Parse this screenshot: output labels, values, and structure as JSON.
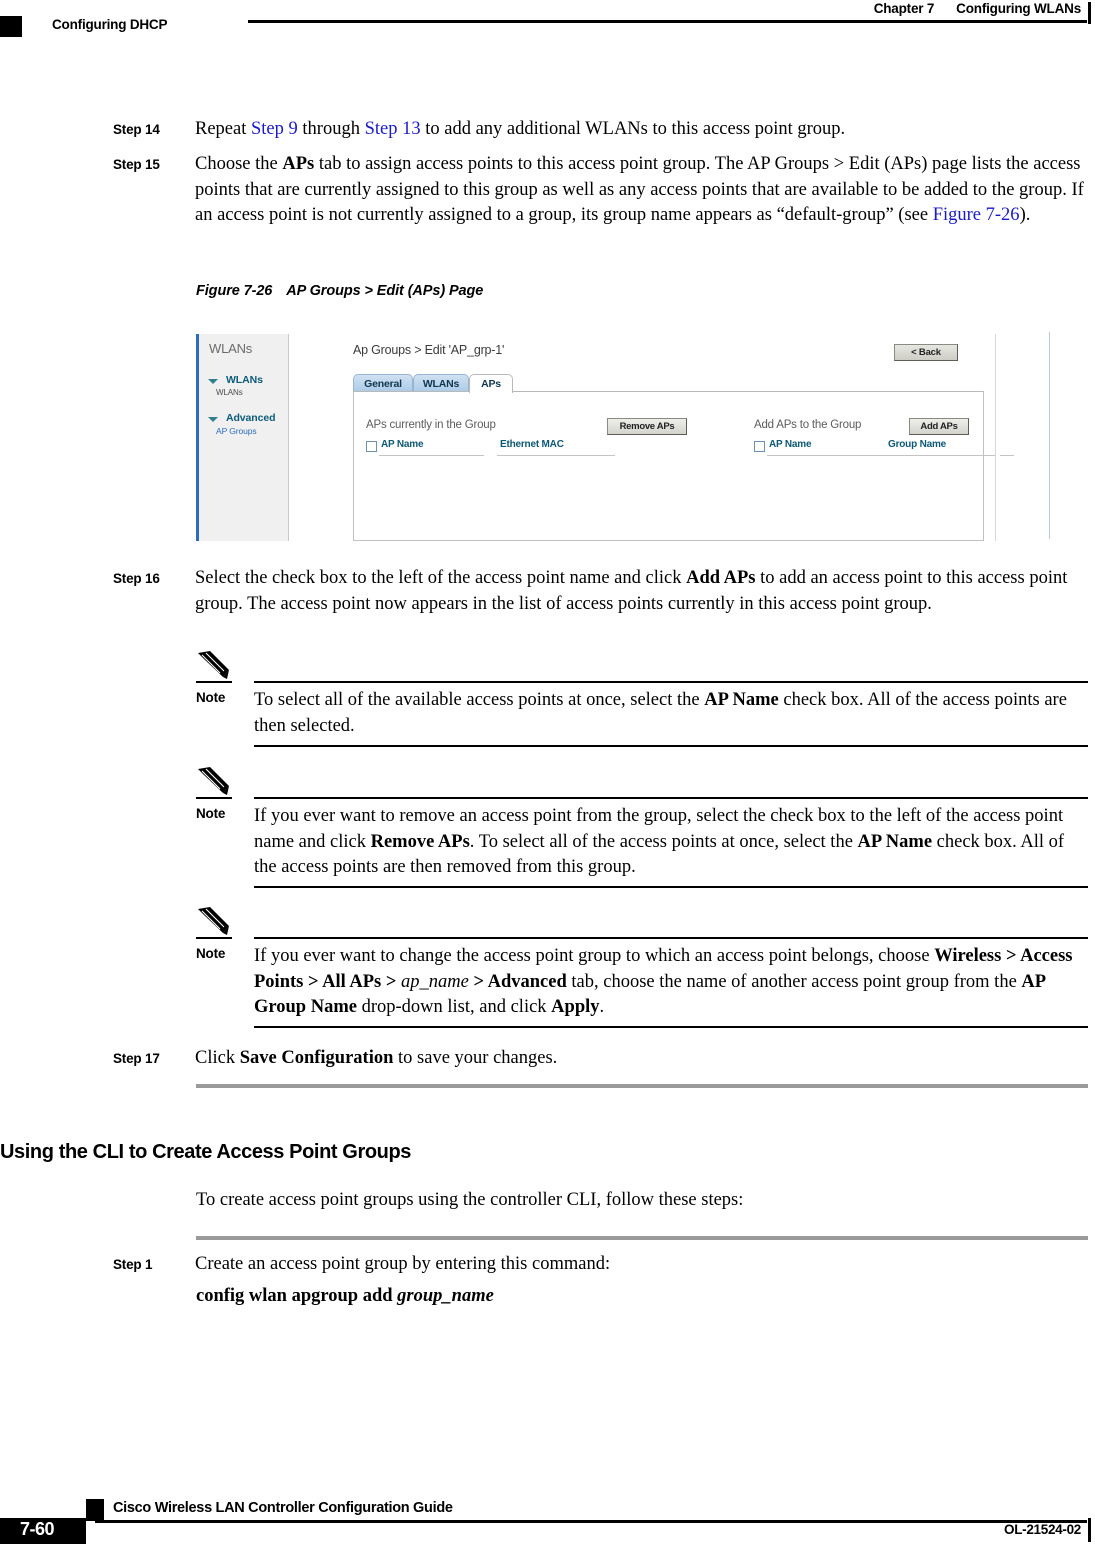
{
  "header": {
    "chapter": "Chapter 7",
    "chapter_title": "Configuring WLANs",
    "running_footer_left": "Configuring DHCP"
  },
  "steps": {
    "step14": {
      "label": "Step 14",
      "text_before": "Repeat ",
      "xref1": "Step 9",
      "text_mid": " through ",
      "xref2": "Step 13",
      "text_after": " to add any additional WLANs to this access point group."
    },
    "step15": {
      "label": "Step 15",
      "p1": "Choose the ",
      "b1": "APs",
      "p2": " tab to assign access points to this access point group. The AP Groups > Edit (APs) page lists the access points that are currently assigned to this group as well as any access points that are available to be added to the group. If an access point is not currently assigned to a group, its group name appears as “default-group” (see ",
      "xref": "Figure 7-26",
      "p3": ")."
    },
    "step16": {
      "label": "Step 16",
      "p1": "Select the check box to the left of the access point name and click ",
      "b1": "Add APs",
      "p2": " to add an access point to this access point group. The access point now appears in the list of access points currently in this access point group."
    },
    "step17": {
      "label": "Step 17",
      "p1": "Click ",
      "b1": "Save Configuration",
      "p2": " to save your changes."
    },
    "cli_step1": {
      "label": "Step 1",
      "p1": "Create an access point group by entering this command:",
      "command_bold": "config wlan apgroup add ",
      "command_italic": "group_name"
    }
  },
  "figure": {
    "caption_number": "Figure 7-26",
    "caption_title": "AP Groups > Edit (APs) Page",
    "figure_id": "207658",
    "screenshot": {
      "sidebar": {
        "title": "WLANs",
        "groups": [
          {
            "heading": "WLANs",
            "sub": "WLANs"
          },
          {
            "heading": "Advanced",
            "sub": "AP Groups"
          }
        ]
      },
      "breadcrumb": "Ap Groups > Edit 'AP_grp-1'",
      "back_button": "< Back",
      "tabs": [
        {
          "label": "General",
          "active": false
        },
        {
          "label": "WLANs",
          "active": false
        },
        {
          "label": "APs",
          "active": true
        }
      ],
      "left_panel": {
        "title": "APs currently in the Group",
        "button": "Remove APs",
        "col1": "AP Name",
        "col2": "Ethernet MAC"
      },
      "right_panel": {
        "title": "Add APs to the Group",
        "button": "Add APs",
        "col1": "AP Name",
        "col2": "Group Name"
      }
    }
  },
  "notes": {
    "label": "Note",
    "note1": {
      "p1": "To select all of the available access points at once, select the ",
      "b1": "AP Name",
      "p2": " check box. All of the access points are then selected."
    },
    "note2": {
      "p1": "If you ever want to remove an access point from the group, select the check box to the left of the access point name and click ",
      "b1": "Remove APs",
      "p2": ". To select all of the access points at once, select the ",
      "b2": "AP Name",
      "p3": " check box. All of the access points are then removed from this group."
    },
    "note3": {
      "p1": "If you ever want to change the access point group to which an access point belongs, choose ",
      "b1": "Wireless > Access Points > All APs > ",
      "i1": "ap_name",
      "b2": " > Advanced",
      "p2": " tab, choose the name of another access point group from the ",
      "b3": "AP Group Name",
      "p3": " drop-down list, and click ",
      "b4": "Apply",
      "p4": "."
    }
  },
  "section": {
    "heading": "Using the CLI to Create Access Point Groups",
    "intro": "To create access point groups using the controller CLI, follow these steps:"
  },
  "footer": {
    "guide_title": "Cisco Wireless LAN Controller Configuration Guide",
    "page_number": "7-60",
    "doc_id": "OL-21524-02"
  }
}
